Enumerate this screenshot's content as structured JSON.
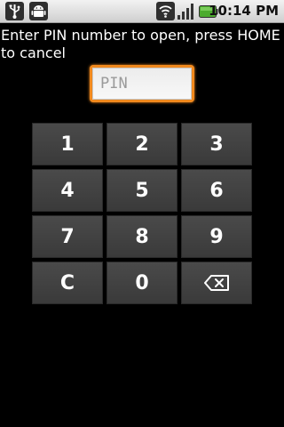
{
  "status_bar": {
    "time": "10:14 PM",
    "icons": {
      "usb": "usb-icon",
      "android": "android-debug-icon",
      "wifi": "wifi-icon",
      "signal": "signal-icon",
      "battery": "battery-icon"
    },
    "battery_color": "#4cab2f"
  },
  "prompt": {
    "text": "Enter PIN number to open, press HOME to cancel"
  },
  "pin_field": {
    "placeholder": "PIN",
    "value": "",
    "focus_color": "#f0891e"
  },
  "keypad": {
    "keys": [
      "1",
      "2",
      "3",
      "4",
      "5",
      "6",
      "7",
      "8",
      "9",
      "C",
      "0"
    ],
    "backspace_icon": "backspace-icon"
  }
}
